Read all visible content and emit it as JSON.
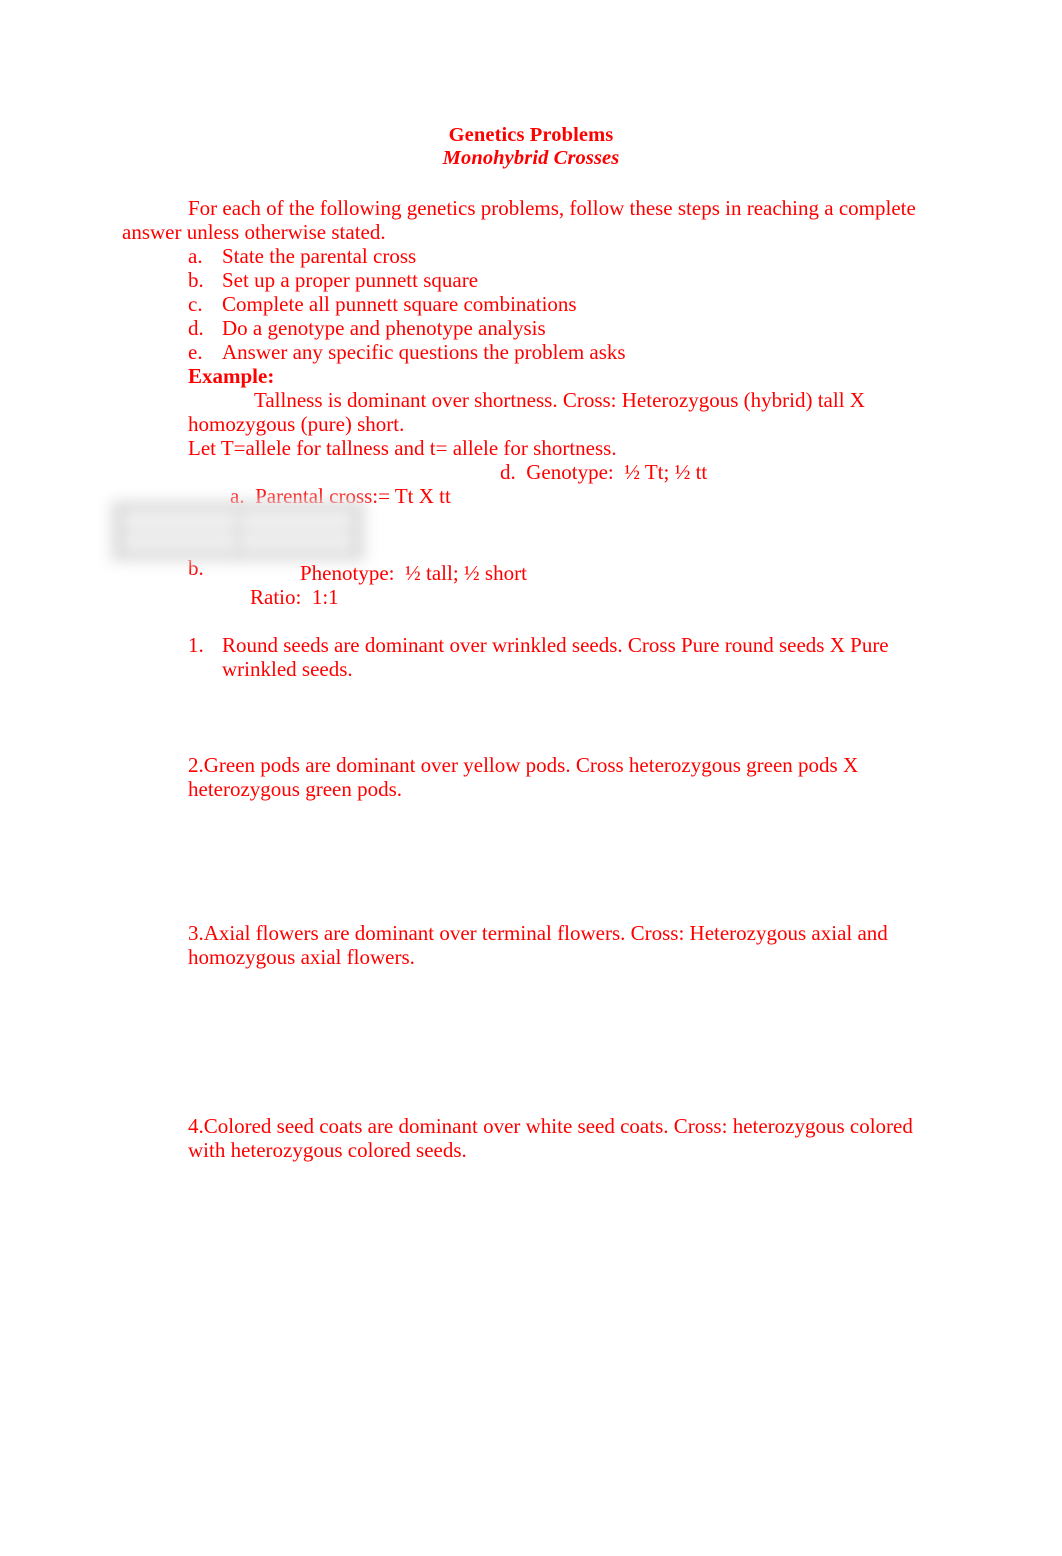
{
  "document": {
    "title": "Genetics Problems",
    "subtitle": "Monohybrid Crosses",
    "text_color": "#ff0000",
    "background_color": "#ffffff"
  },
  "intro": {
    "paragraph": "For each of the following genetics problems, follow these steps in reaching a complete answer unless otherwise stated."
  },
  "steps": [
    {
      "letter": "a.",
      "text": "State the parental cross"
    },
    {
      "letter": "b.",
      "text": "Set up a proper punnett square"
    },
    {
      "letter": "c.",
      "text": "Complete all punnett square combinations"
    },
    {
      "letter": "d.",
      "text": "Do a genotype and phenotype analysis"
    },
    {
      "letter": "e.",
      "text": "Answer any specific questions the problem asks"
    }
  ],
  "example": {
    "heading": "Example:",
    "statement": "Tallness is dominant over shortness.  Cross:  Heterozygous (hybrid) tall X homozygous (pure) short.",
    "allele_key": "Let T=allele for tallness and t= allele for shortness.",
    "parental_cross": "a.  Parental cross:= Tt X tt",
    "genotype": "d.  Genotype:  ½ Tt; ½ tt",
    "punnett_label": "b.",
    "punnett_square": {
      "state": "blurred-redacted",
      "rows": 2,
      "columns": 2
    },
    "phenotype": "Phenotype:  ½ tall; ½ short",
    "ratio": "Ratio:  1:1"
  },
  "problems": [
    {
      "id": "problem-1",
      "number": "1.",
      "text": "Round seeds are dominant over wrinkled seeds.  Cross Pure round seeds X Pure wrinkled seeds."
    },
    {
      "id": "problem-2",
      "number": "2.",
      "text": "2.Green pods are dominant over yellow pods.  Cross heterozygous green pods X heterozygous green pods."
    },
    {
      "id": "problem-3",
      "number": "3.",
      "text": "3.Axial flowers are dominant over terminal flowers.  Cross:  Heterozygous axial and homozygous axial flowers."
    },
    {
      "id": "problem-4",
      "number": "4.",
      "text": "4.Colored seed coats are dominant over white seed coats.  Cross:  heterozygous colored with heterozygous colored seeds."
    }
  ]
}
